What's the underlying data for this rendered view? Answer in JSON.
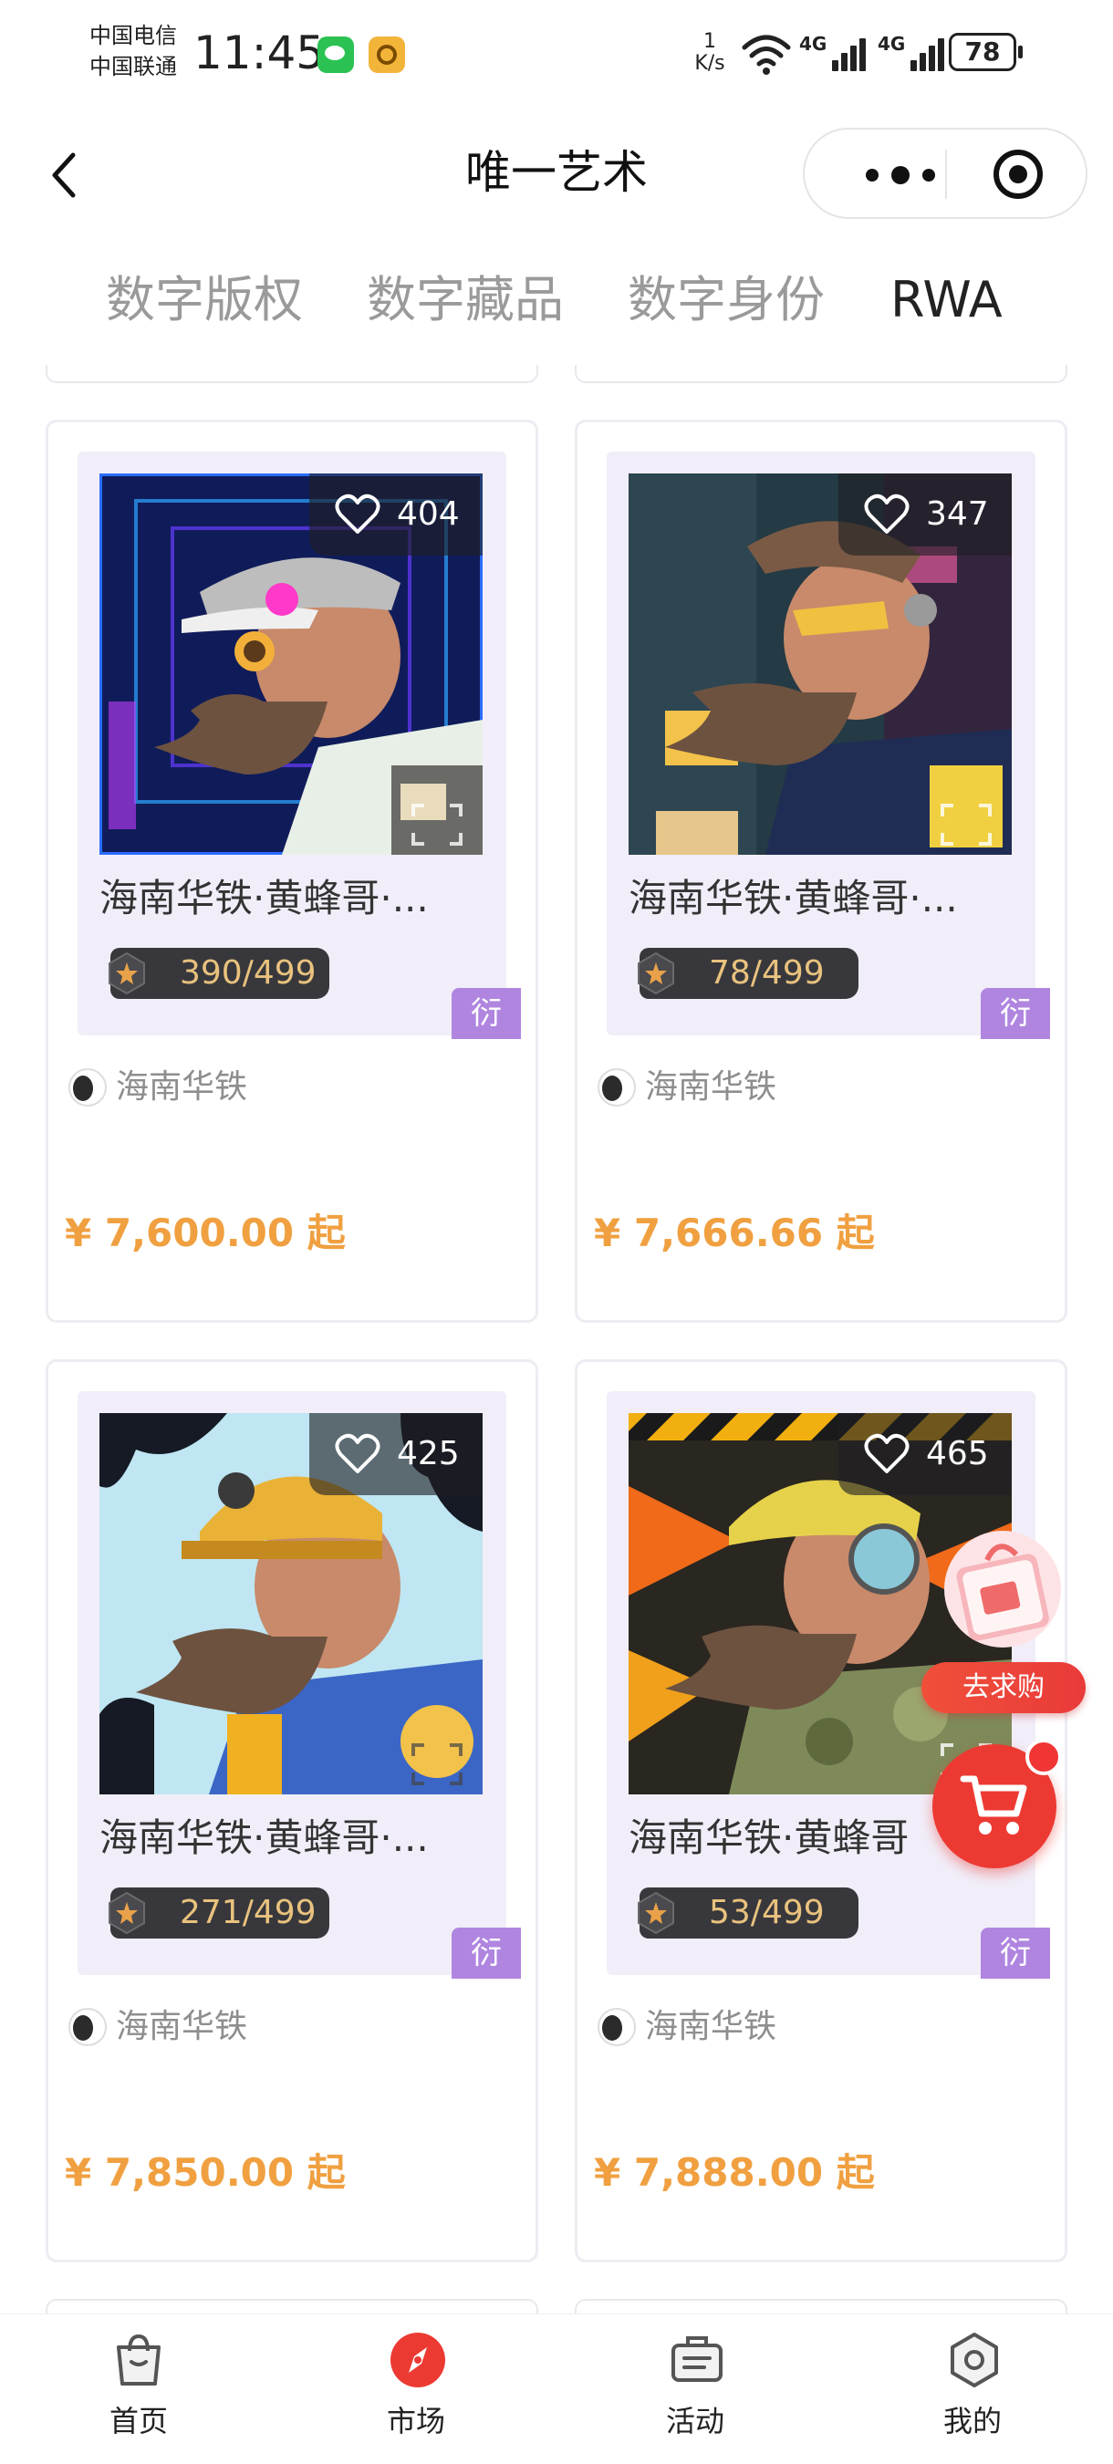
{
  "status_bar": {
    "carrier_1": "中国电信",
    "carrier_2": "中国联通",
    "time": "11:45",
    "net_speed_value": "1",
    "net_speed_unit": "K/s",
    "sim1_label": "4G",
    "sim2_label": "4G",
    "battery": "78"
  },
  "nav": {
    "title": "唯一艺术",
    "back_icon": "chevron-left-icon",
    "more_icon": "more-dots-icon",
    "close_icon": "target-close-icon"
  },
  "tabs": [
    {
      "label": "数字版权",
      "active": false
    },
    {
      "label": "数字藏品",
      "active": false
    },
    {
      "label": "数字身份",
      "active": false
    },
    {
      "label": "RWA",
      "active": true
    }
  ],
  "products": [
    {
      "likes": "404",
      "name": "海南华铁·黄蜂哥·...",
      "stock": "390/499",
      "tag": "衍",
      "issuer": "海南华铁",
      "price": "¥ 7,600.00 起"
    },
    {
      "likes": "347",
      "name": "海南华铁·黄蜂哥·...",
      "stock": "78/499",
      "tag": "衍",
      "issuer": "海南华铁",
      "price": "¥ 7,666.66 起"
    },
    {
      "likes": "425",
      "name": "海南华铁·黄蜂哥·...",
      "stock": "271/499",
      "tag": "衍",
      "issuer": "海南华铁",
      "price": "¥ 7,850.00 起"
    },
    {
      "likes": "465",
      "name": "海南华铁·黄蜂哥",
      "stock": "53/499",
      "tag": "衍",
      "issuer": "海南华铁",
      "price": "¥ 7,888.00 起"
    }
  ],
  "floating": {
    "buy_request_label": "去求购",
    "cart_icon": "shopping-cart-icon"
  },
  "bottom_nav": [
    {
      "label": "首页",
      "icon": "shopping-bag-icon",
      "active": false
    },
    {
      "label": "市场",
      "icon": "compass-icon",
      "active": true
    },
    {
      "label": "活动",
      "icon": "briefcase-icon",
      "active": false
    },
    {
      "label": "我的",
      "icon": "hexagon-icon",
      "active": false
    }
  ],
  "colors": {
    "price": "#f0a040",
    "tag_bg": "#b085e0",
    "active_nav": "#ec3a33",
    "stock_text": "#e9c27e"
  }
}
